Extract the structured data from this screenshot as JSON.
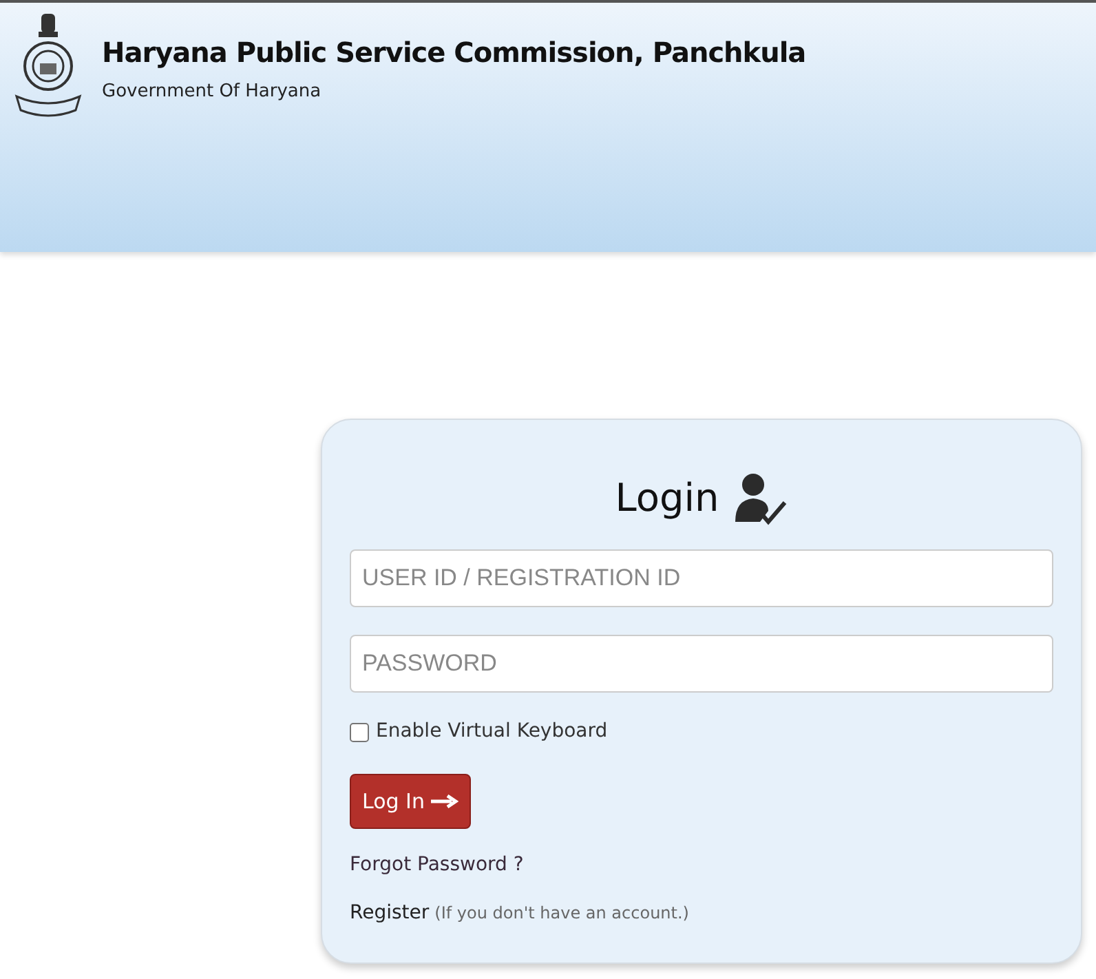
{
  "header": {
    "title": "Haryana Public Service Commission, Panchkula",
    "subtitle": "Government Of Haryana"
  },
  "login": {
    "title": "Login",
    "fields": [
      {
        "placeholder": "USER ID / REGISTRATION ID"
      },
      {
        "placeholder": "PASSWORD"
      }
    ],
    "virtual_keyboard": {
      "label": "Enable Virtual Keyboard",
      "checked": false
    },
    "button": "Log In",
    "forgot_link": "Forgot Password ?",
    "register_link": "Register",
    "register_note": "(If you don't have an account.)"
  }
}
